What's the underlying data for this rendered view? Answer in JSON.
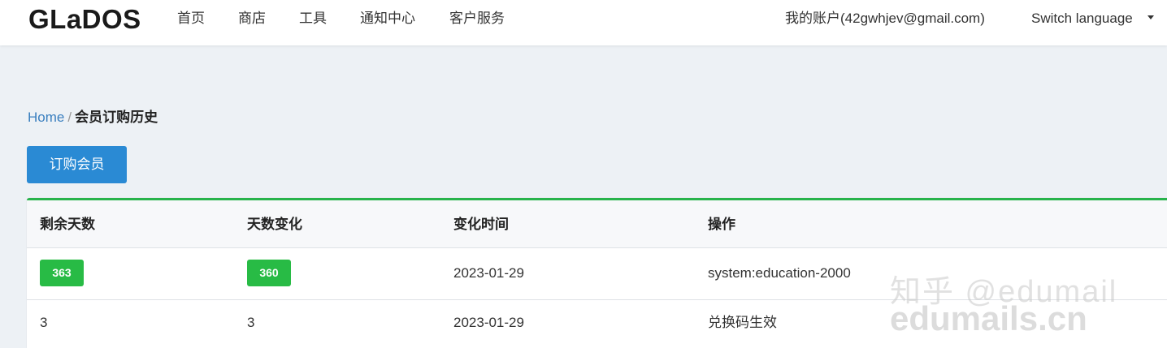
{
  "navbar": {
    "brand": "GLaDOS",
    "items": [
      "首页",
      "商店",
      "工具",
      "通知中心",
      "客户服务"
    ],
    "account": "我的账户(42gwhjev@gmail.com)",
    "language": "Switch language"
  },
  "breadcrumb": {
    "home": "Home",
    "separator": "/",
    "current": "会员订购历史"
  },
  "actions": {
    "order_button": "订购会员"
  },
  "table": {
    "headers": [
      "剩余天数",
      "天数变化",
      "变化时间",
      "操作"
    ],
    "rows": [
      {
        "remaining": "363",
        "change": "360",
        "time": "2023-01-29",
        "action": "system:education-2000",
        "badged": true
      },
      {
        "remaining": "3",
        "change": "3",
        "time": "2023-01-29",
        "action": "兑换码生效",
        "badged": false
      }
    ]
  },
  "watermark": {
    "line1": "知乎 @edumail",
    "line2": "edumails.cn"
  },
  "colors": {
    "primary": "#2a8ad4",
    "success": "#28bb45",
    "table_accent": "#28b34b",
    "link": "#3a7fbf",
    "background": "#edf1f5"
  },
  "icons": {
    "language_dropdown": "caret-down-icon"
  }
}
